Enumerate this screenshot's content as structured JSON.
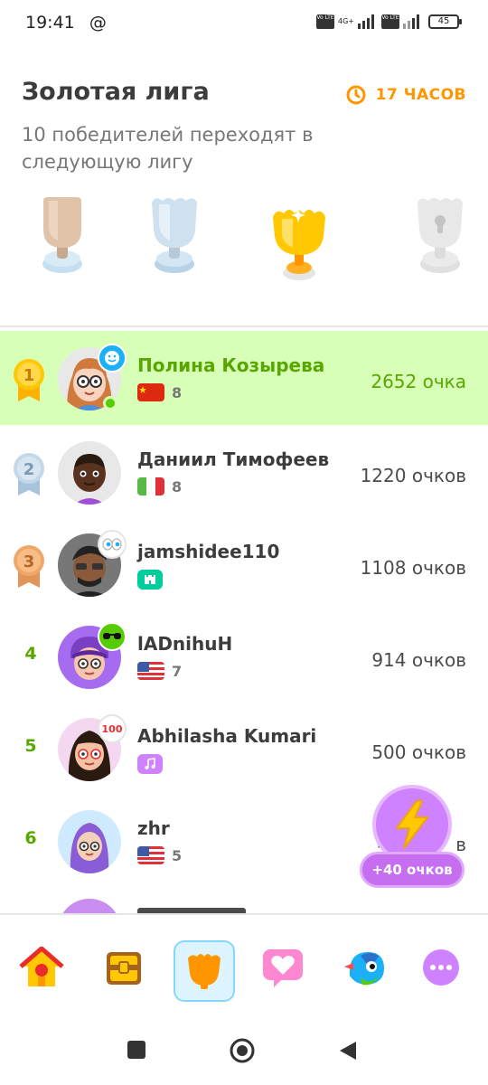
{
  "status_bar": {
    "time": "19:41",
    "at_symbol": "@",
    "volte1": "Vo LTE",
    "network": "4G+",
    "volte2": "Vo LTE",
    "battery": "45"
  },
  "header": {
    "league_title": "Золотая лига",
    "timer": "17 ЧАСОВ",
    "subtitle": "10 победителей переходят в следующую лигу"
  },
  "trophies": [
    {
      "name": "bronze",
      "state": "passed"
    },
    {
      "name": "silver",
      "state": "passed"
    },
    {
      "name": "gold",
      "state": "current"
    },
    {
      "name": "sapphire",
      "state": "locked"
    }
  ],
  "leaderboard": [
    {
      "rank": "1",
      "name": "Полина Козырева",
      "streak": "8",
      "flag": "china",
      "xp": "2652 очка",
      "is_me": true,
      "online": true,
      "badge": "smile-badge"
    },
    {
      "rank": "2",
      "name": "Даниил Тимофеев",
      "streak": "8",
      "flag": "italy",
      "xp": "1220 очков",
      "is_me": false
    },
    {
      "rank": "3",
      "name": "jamshidee110",
      "streak": "",
      "flag": "castle-chip",
      "xp": "1108 очков",
      "is_me": false,
      "badge": "eyes-badge"
    },
    {
      "rank": "4",
      "name": "lADnihuH",
      "streak": "7",
      "flag": "usa",
      "xp": "914 очков",
      "is_me": false,
      "badge": "sunglasses-badge"
    },
    {
      "rank": "5",
      "name": "Abhilasha Kumari",
      "streak": "",
      "flag": "music-chip",
      "xp": "500 очков",
      "is_me": false,
      "badge": "100-badge"
    },
    {
      "rank": "6",
      "name": "zhr",
      "streak": "5",
      "flag": "usa",
      "xp": "4",
      "xp_tail": "в",
      "is_me": false
    }
  ],
  "boost": {
    "label": "+40 очков",
    "icon": "lightning-icon"
  },
  "bottom_nav": [
    {
      "name": "home",
      "icon": "house-icon"
    },
    {
      "name": "chest",
      "icon": "chest-icon"
    },
    {
      "name": "leagues",
      "icon": "trophy-shield-icon",
      "active": true
    },
    {
      "name": "friends",
      "icon": "heart-chat-icon"
    },
    {
      "name": "character",
      "icon": "bird-icon"
    },
    {
      "name": "more",
      "icon": "more-icon"
    }
  ],
  "colors": {
    "accent_green": "#58a700",
    "highlight_row": "#d7ffb8",
    "timer_orange": "#ff9600",
    "boost_purple": "#ce82ff"
  }
}
